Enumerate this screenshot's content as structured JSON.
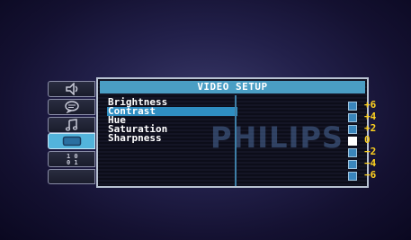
{
  "brand_watermark": "PHILIPS",
  "menu": {
    "title": "VIDEO SETUP",
    "items": [
      {
        "label": "Brightness",
        "selected": false
      },
      {
        "label": "Contrast",
        "selected": true
      },
      {
        "label": "Hue",
        "selected": false
      },
      {
        "label": "Saturation",
        "selected": false
      },
      {
        "label": "Sharpness",
        "selected": false
      }
    ]
  },
  "tabs": [
    {
      "icon": "speaker-icon",
      "active": false
    },
    {
      "icon": "speech-bubble-icon",
      "active": false
    },
    {
      "icon": "music-note-icon",
      "active": false
    },
    {
      "icon": "display-icon",
      "active": true
    },
    {
      "icon": "preferences-icon",
      "active": false
    }
  ],
  "levels": [
    "+6",
    "+4",
    "+2",
    "0",
    "−2",
    "−4",
    "−6"
  ],
  "current_level": "0",
  "colors": {
    "title_bar": "#4a9ec4",
    "selection": "#2f8ec2",
    "level_text": "#ffd21f",
    "active_tab": "#53b4dc"
  }
}
